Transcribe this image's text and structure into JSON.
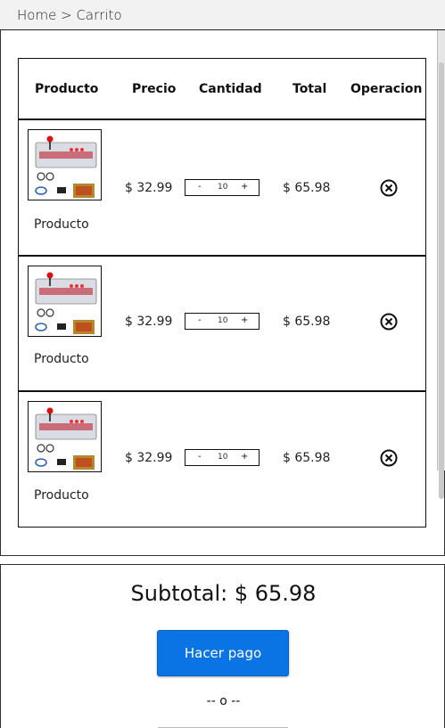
{
  "breadcrumb": {
    "home": "Home",
    "separator": ">",
    "current": "Carrito"
  },
  "table": {
    "headers": {
      "producto": "Producto",
      "precio": "Precio",
      "cantidad": "Cantidad",
      "total": "Total",
      "operacion": "Operacion"
    },
    "rows": [
      {
        "name": "Producto",
        "price": "$ 32.99",
        "qty": "10",
        "total": "$ 65.98"
      },
      {
        "name": "Producto",
        "price": "$ 32.99",
        "qty": "10",
        "total": "$ 65.98"
      },
      {
        "name": "Producto",
        "price": "$ 32.99",
        "qty": "10",
        "total": "$ 65.98"
      }
    ],
    "minus_label": "-",
    "plus_label": "+"
  },
  "summary": {
    "subtotal": "Subtotal: $ 65.98",
    "pay_button": "Hacer pago",
    "or_separator": "-- o --"
  },
  "colors": {
    "accent": "#0b74e5",
    "breadcrumb_bg": "#f2f2f2"
  }
}
